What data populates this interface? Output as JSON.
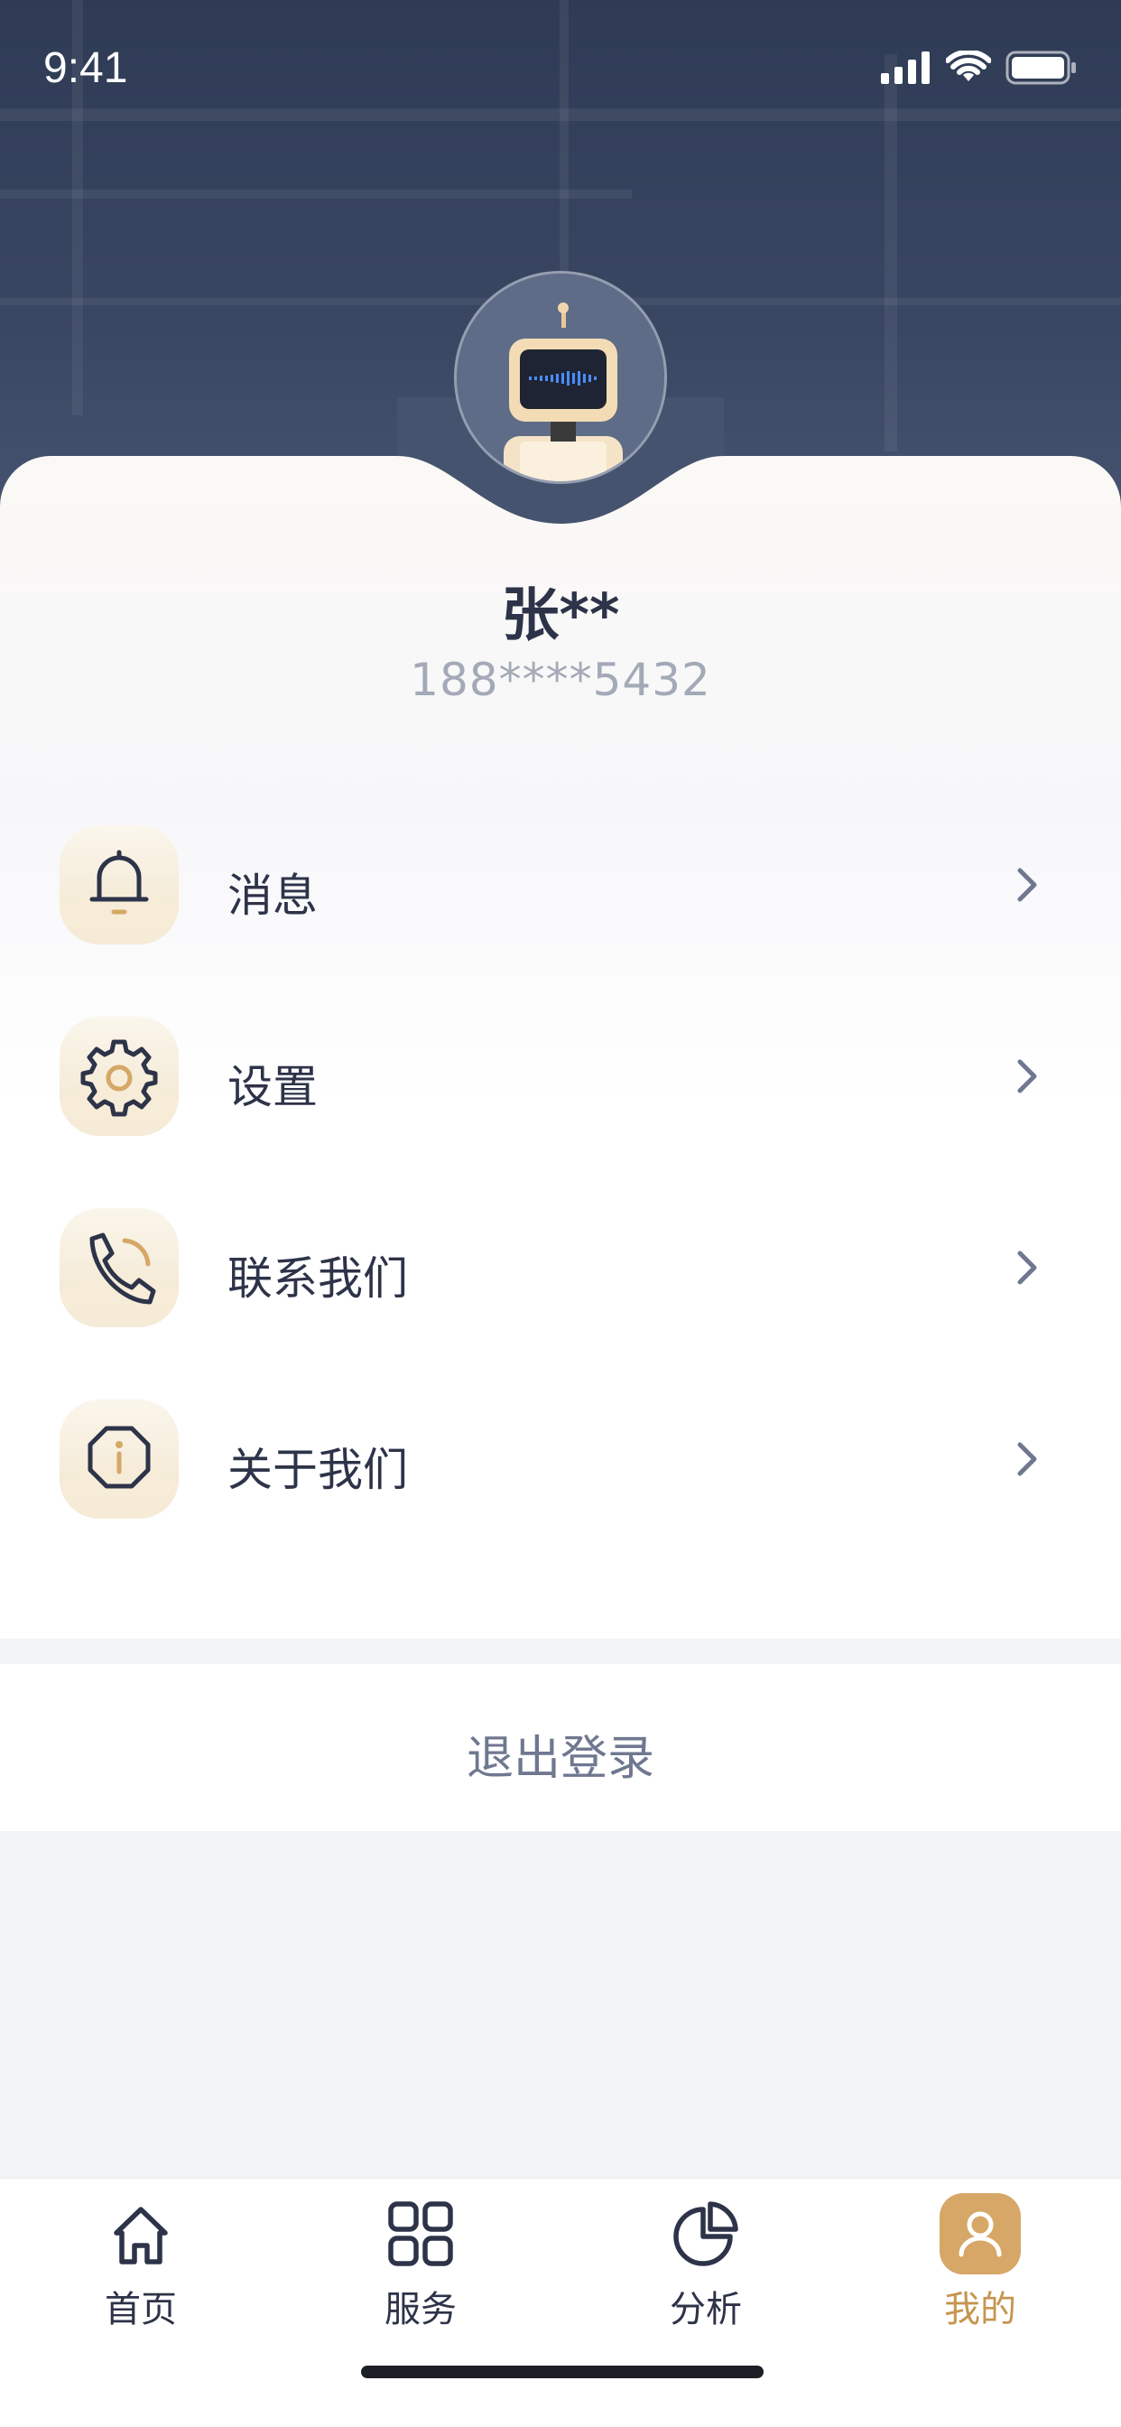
{
  "status_bar": {
    "time": "9:41"
  },
  "profile": {
    "name": "张**",
    "phone": "188****5432"
  },
  "menu": [
    {
      "label": "消息",
      "icon": "bell-icon"
    },
    {
      "label": "设置",
      "icon": "gear-icon"
    },
    {
      "label": "联系我们",
      "icon": "phone-icon"
    },
    {
      "label": "关于我们",
      "icon": "info-icon"
    }
  ],
  "logout": {
    "label": "退出登录"
  },
  "tabbar": [
    {
      "label": "首页",
      "icon": "home-icon",
      "active": false
    },
    {
      "label": "服务",
      "icon": "grid-icon",
      "active": false
    },
    {
      "label": "分析",
      "icon": "pie-chart-icon",
      "active": false
    },
    {
      "label": "我的",
      "icon": "user-icon",
      "active": true
    }
  ],
  "colors": {
    "accent": "#d6a766",
    "accent_text": "#c6954f",
    "header_bg": "#2f3b55",
    "text": "#2d3348",
    "muted": "#a3a9b7"
  }
}
